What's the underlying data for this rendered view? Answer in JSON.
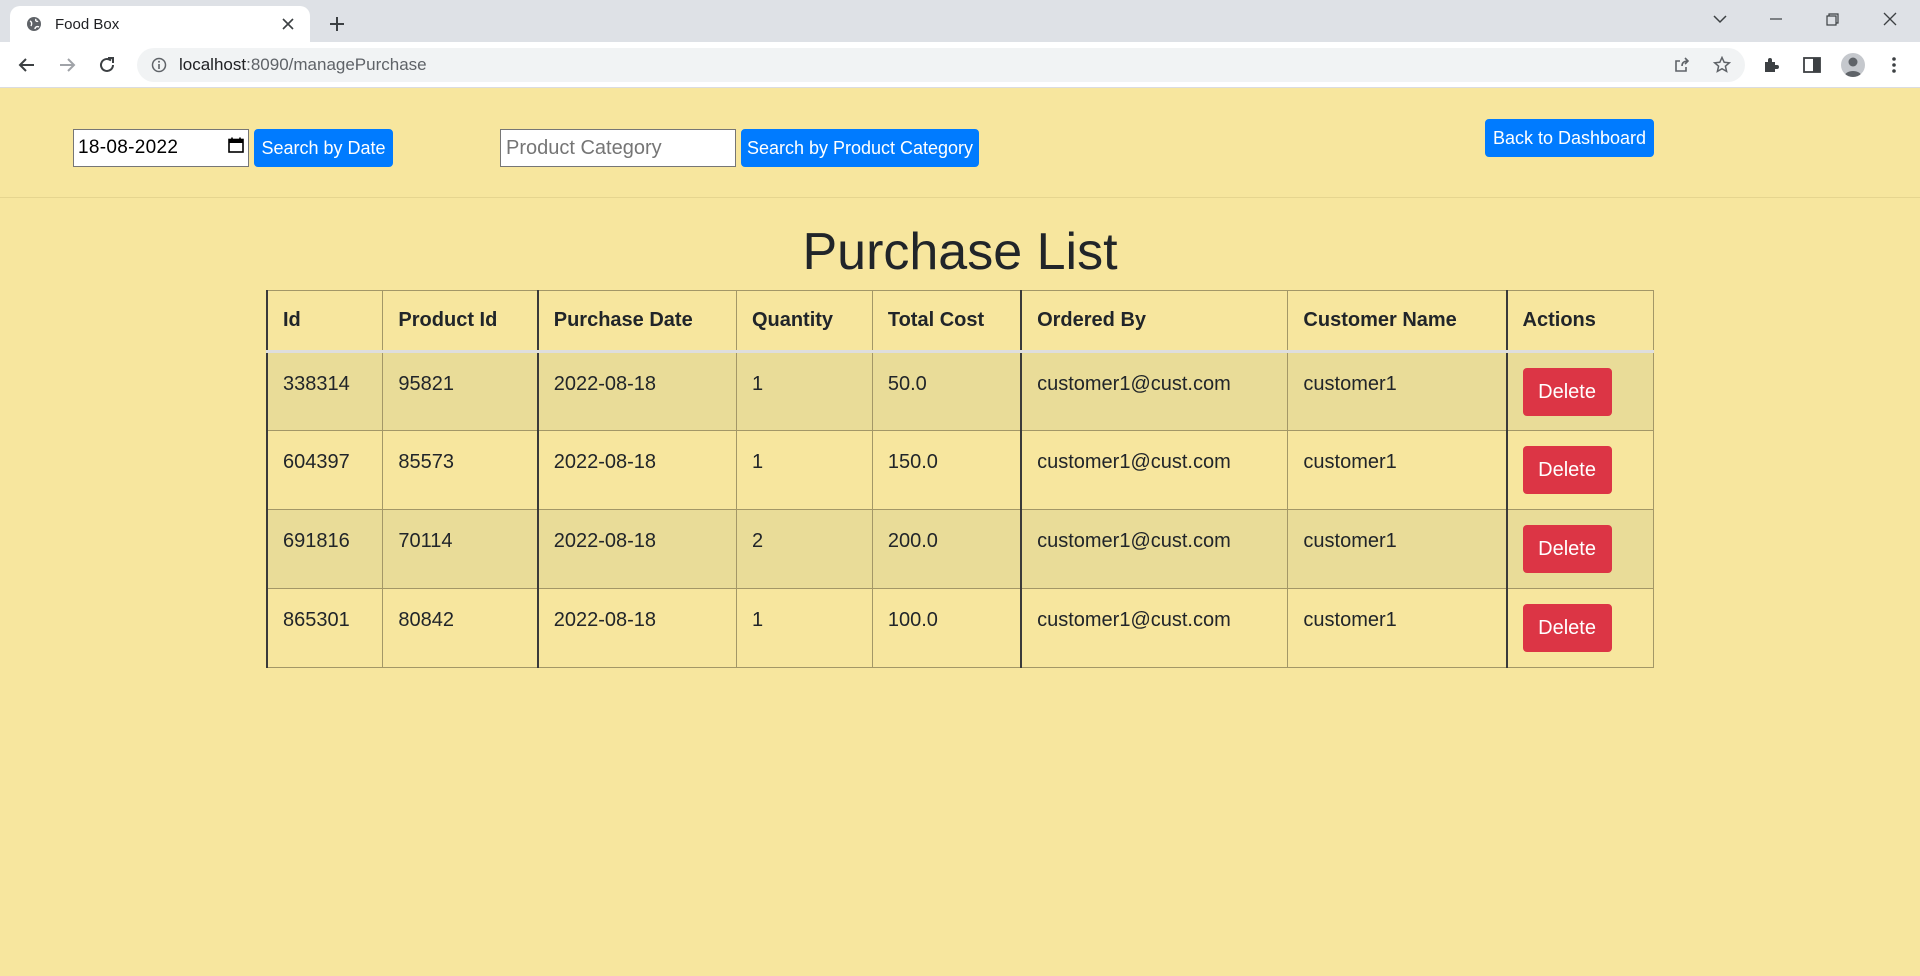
{
  "browser": {
    "tab_title": "Food Box",
    "url_host": "localhost",
    "url_rest": ":8090/managePurchase"
  },
  "filters": {
    "date_value": "18-08-2022",
    "search_date_label": "Search by Date",
    "category_placeholder": "Product Category",
    "category_value": "",
    "search_category_label": "Search by Product Category",
    "back_label": "Back to Dashboard"
  },
  "page": {
    "title": "Purchase List"
  },
  "table": {
    "headers": [
      "Id",
      "Product Id",
      "Purchase Date",
      "Quantity",
      "Total Cost",
      "Ordered By",
      "Customer Name",
      "Actions"
    ],
    "rows": [
      {
        "id": "338314",
        "product_id": "95821",
        "date": "2022-08-18",
        "quantity": "1",
        "total": "50.0",
        "ordered_by": "customer1@cust.com",
        "customer": "customer1",
        "action": "Delete"
      },
      {
        "id": "604397",
        "product_id": "85573",
        "date": "2022-08-18",
        "quantity": "1",
        "total": "150.0",
        "ordered_by": "customer1@cust.com",
        "customer": "customer1",
        "action": "Delete"
      },
      {
        "id": "691816",
        "product_id": "70114",
        "date": "2022-08-18",
        "quantity": "2",
        "total": "200.0",
        "ordered_by": "customer1@cust.com",
        "customer": "customer1",
        "action": "Delete"
      },
      {
        "id": "865301",
        "product_id": "80842",
        "date": "2022-08-18",
        "quantity": "1",
        "total": "100.0",
        "ordered_by": "customer1@cust.com",
        "customer": "customer1",
        "action": "Delete"
      }
    ]
  },
  "colors": {
    "page_bg": "#f7e69e",
    "primary": "#007bff",
    "danger": "#dc3545"
  }
}
